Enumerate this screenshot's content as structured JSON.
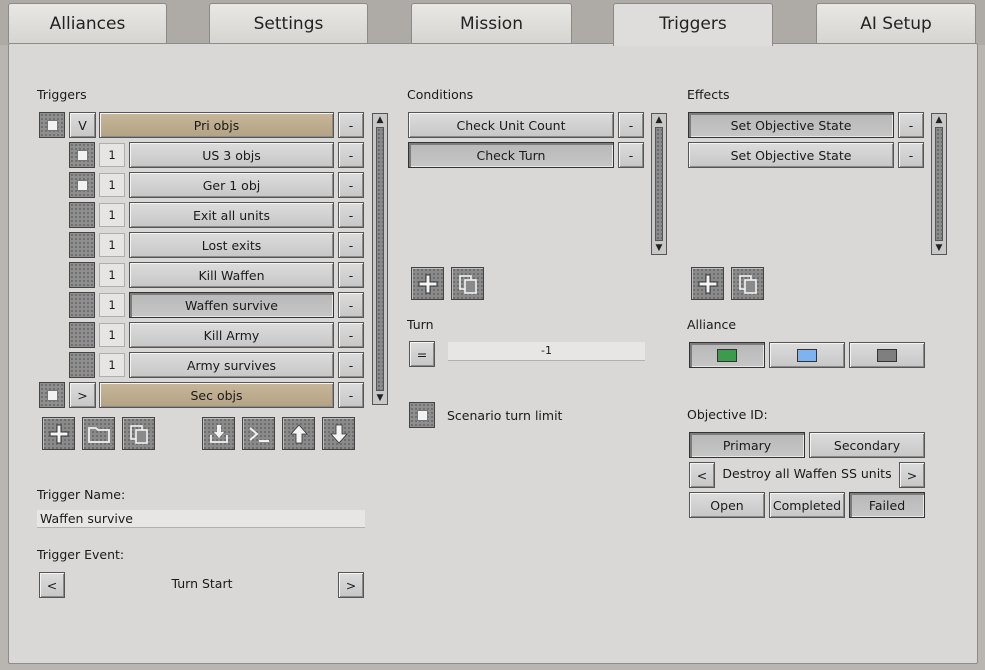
{
  "tabs": [
    "Alliances",
    "Settings",
    "Mission",
    "Triggers",
    "AI Setup"
  ],
  "triggers": {
    "title": "Triggers",
    "items": [
      {
        "toggle": "V",
        "label": "Pri objs",
        "group": true,
        "checked": true
      },
      {
        "num": "1",
        "label": "US 3 objs",
        "checked": true
      },
      {
        "num": "1",
        "label": "Ger 1 obj",
        "checked": true
      },
      {
        "num": "1",
        "label": "Exit all units",
        "checked": false
      },
      {
        "num": "1",
        "label": "Lost exits",
        "checked": false
      },
      {
        "num": "1",
        "label": "Kill Waffen",
        "checked": false
      },
      {
        "num": "1",
        "label": "Waffen survive",
        "checked": false,
        "selected": true
      },
      {
        "num": "1",
        "label": "Kill Army",
        "checked": false
      },
      {
        "num": "1",
        "label": "Army survives",
        "checked": false
      },
      {
        "toggle": ">",
        "label": "Sec objs",
        "group": true,
        "checked": true
      }
    ],
    "remove_label": "-",
    "icons": [
      "add-icon",
      "folder-icon",
      "copy-icon",
      "import-icon",
      "console-icon",
      "move-up-icon",
      "move-down-icon"
    ]
  },
  "trigger_name": {
    "label": "Trigger Name:",
    "value": "Waffen survive"
  },
  "trigger_event": {
    "label": "Trigger Event:",
    "value": "Turn Start",
    "prev": "<",
    "next": ">"
  },
  "conditions": {
    "title": "Conditions",
    "items": [
      {
        "label": "Check Unit Count",
        "selected": false
      },
      {
        "label": "Check Turn",
        "selected": true
      }
    ],
    "remove_label": "-"
  },
  "turn": {
    "label": "Turn",
    "operator": "=",
    "value": "-1"
  },
  "scenario_turn_limit": {
    "label": "Scenario turn limit"
  },
  "effects": {
    "title": "Effects",
    "items": [
      {
        "label": "Set Objective State",
        "selected": true
      },
      {
        "label": "Set Objective State",
        "selected": false
      }
    ],
    "remove_label": "-"
  },
  "alliance": {
    "label": "Alliance",
    "colors": [
      "#3c9b4c",
      "#7fb2f0",
      "#7f7f7f"
    ],
    "selected_index": 0
  },
  "objective": {
    "label": "Objective ID:",
    "types": [
      "Primary",
      "Secondary"
    ],
    "selected_type": "Primary",
    "prev": "<",
    "next": ">",
    "name": "Destroy all Waffen SS units",
    "states": [
      "Open",
      "Completed",
      "Failed"
    ],
    "selected_state": "Failed"
  }
}
